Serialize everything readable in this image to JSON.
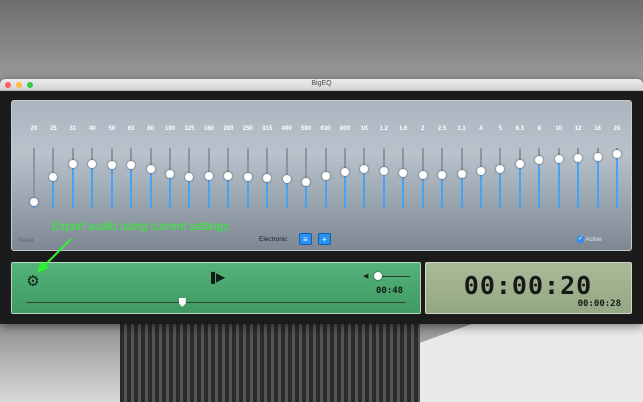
{
  "window": {
    "title": "BigEQ"
  },
  "equalizer": {
    "bands": [
      {
        "freq": "20",
        "level": 0.1
      },
      {
        "freq": "25",
        "level": 0.52
      },
      {
        "freq": "31",
        "level": 0.73
      },
      {
        "freq": "40",
        "level": 0.73
      },
      {
        "freq": "50",
        "level": 0.71
      },
      {
        "freq": "63",
        "level": 0.71
      },
      {
        "freq": "80",
        "level": 0.65
      },
      {
        "freq": "100",
        "level": 0.57
      },
      {
        "freq": "125",
        "level": 0.52
      },
      {
        "freq": "160",
        "level": 0.53
      },
      {
        "freq": "200",
        "level": 0.53
      },
      {
        "freq": "250",
        "level": 0.52
      },
      {
        "freq": "315",
        "level": 0.5
      },
      {
        "freq": "400",
        "level": 0.48
      },
      {
        "freq": "500",
        "level": 0.43
      },
      {
        "freq": "630",
        "level": 0.53
      },
      {
        "freq": "800",
        "level": 0.6
      },
      {
        "freq": "1K",
        "level": 0.65
      },
      {
        "freq": "1.2",
        "level": 0.62
      },
      {
        "freq": "1.6",
        "level": 0.58
      },
      {
        "freq": "2",
        "level": 0.55
      },
      {
        "freq": "2.5",
        "level": 0.55
      },
      {
        "freq": "3.1",
        "level": 0.57
      },
      {
        "freq": "4",
        "level": 0.62
      },
      {
        "freq": "5",
        "level": 0.65
      },
      {
        "freq": "6.3",
        "level": 0.73
      },
      {
        "freq": "8",
        "level": 0.8
      },
      {
        "freq": "10",
        "level": 0.82
      },
      {
        "freq": "12",
        "level": 0.83
      },
      {
        "freq": "16",
        "level": 0.85
      },
      {
        "freq": "20",
        "level": 0.9
      }
    ],
    "reset_label": "Reset",
    "preset_name": "Electronic",
    "preset_menu_icon": "list-icon",
    "add_preset_icon": "plus-icon",
    "active_label": "Active",
    "active_checked": true,
    "accent_color": "#4aa3f2"
  },
  "player": {
    "settings_icon": "gear-icon",
    "play_pause_icon": "play-pause-icon",
    "volume_icon": "speaker-icon",
    "volume_level": 0.1,
    "elapsed": "00:48",
    "seek_position": 0.41,
    "panel_color": "#4aa86d"
  },
  "clock": {
    "main_time": "00:00:20",
    "sub_time": "00:00:28",
    "panel_color": "#a3b592"
  },
  "annotation": {
    "text": "Export audio using current settings",
    "color": "#2ff22f"
  }
}
